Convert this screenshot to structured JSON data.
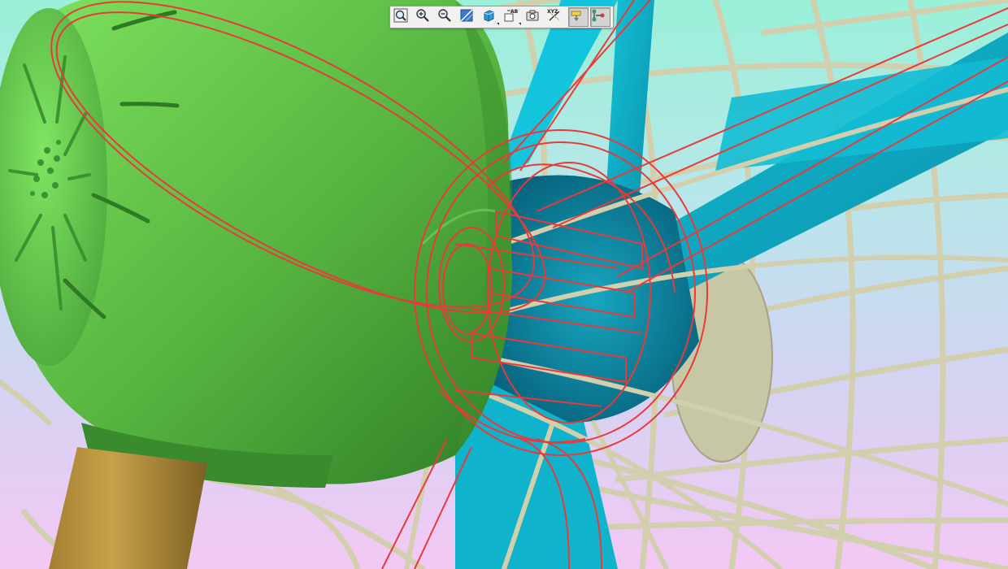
{
  "viewport": {
    "background_top": "#9af0d8",
    "background_bottom": "#f3c8f4",
    "colors": {
      "motor_housing": "#5db946",
      "fan_blades": "#0fb6d0",
      "guard_grill": "#d2cfae",
      "stand_pole": "#b18f3c",
      "selection_wireframe": "#e83a3a",
      "hub_cap": "#c8c7a5"
    }
  },
  "toolbar": {
    "tools": [
      {
        "id": "zoom-fit",
        "icon": "zoom-fit-icon"
      },
      {
        "id": "zoom-in",
        "icon": "zoom-in-icon"
      },
      {
        "id": "zoom-out",
        "icon": "zoom-out-icon"
      },
      {
        "id": "section-view",
        "icon": "section-icon"
      },
      {
        "id": "display-style",
        "icon": "shaded-cube-icon"
      },
      {
        "id": "annotations",
        "icon": "annotation-icon",
        "text": "AB"
      },
      {
        "id": "snapshot",
        "icon": "camera-icon"
      },
      {
        "id": "datum-axes",
        "icon": "axes-icon",
        "text": "XYZ"
      },
      {
        "id": "datum-planes",
        "icon": "datum-plane-icon",
        "active": true
      },
      {
        "id": "connector",
        "icon": "connector-icon",
        "active": true
      }
    ]
  }
}
